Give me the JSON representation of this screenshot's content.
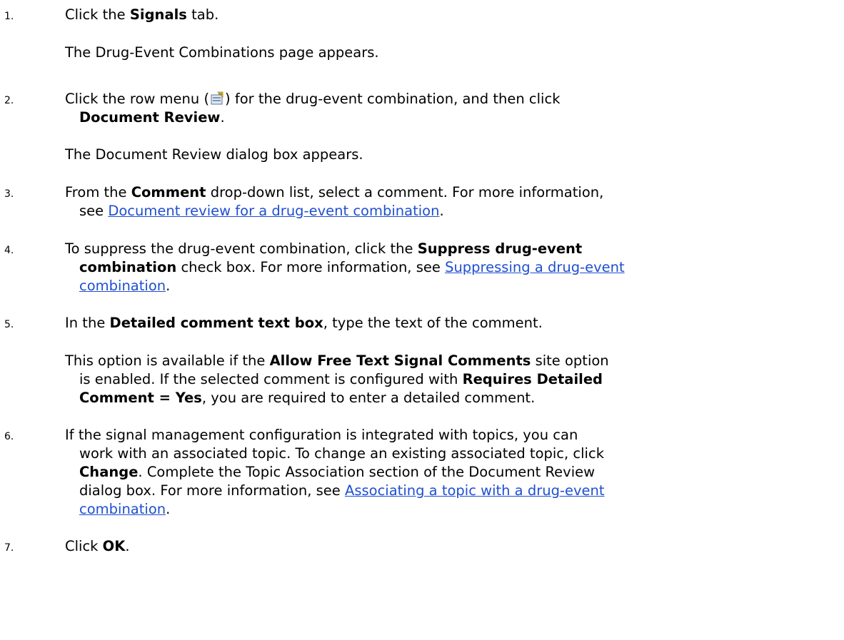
{
  "steps": [
    {
      "number": "1.",
      "text_before": "Click the ",
      "bold": "Signals",
      "text_after": " tab.",
      "result": "The Drug-Event Combinations page appears."
    },
    {
      "number": "2.",
      "text_before": "Click the row menu (",
      "icon": "row-menu-icon",
      "text_mid": ") for the drug-event combination, and then click",
      "bold": "Document Review",
      "text_after": ".",
      "result": "The Document Review dialog box appears."
    },
    {
      "number": "3.",
      "text_before": "From the ",
      "bold": "Comment",
      "text_after": " drop-down list, select a comment. For more information,",
      "text_see": "see ",
      "link": "Document review for a drug-event combination",
      "text_end": "."
    },
    {
      "number": "4.",
      "text_before": "To suppress the drug-event combination, click the ",
      "bold1": "Suppress drug-event",
      "bold2": "combination",
      "text_mid": " check box. For more information, see ",
      "link1": "Suppressing a drug-event",
      "link2": "combination",
      "text_end": "."
    },
    {
      "number": "5.",
      "text_before": "In the ",
      "bold": "Detailed comment text box",
      "text_after": ", type the text of the comment.",
      "note_1a": "This option is available if the ",
      "note_1b": "Allow Free Text Signal Comments",
      "note_1c": " site option",
      "note_2a": "is enabled. If the selected comment is configured with ",
      "note_2b": "Requires Detailed",
      "note_3a": "Comment = Yes",
      "note_3b": ", you are required to enter a detailed comment."
    },
    {
      "number": "6.",
      "line1": "If the signal management configuration is integrated with topics, you can",
      "line2": "work with an associated topic. To change an existing associated topic, click",
      "bold": "Change",
      "line3": ". Complete the Topic Association section of the Document Review",
      "line4": "dialog box. For more information, see ",
      "link1": "Associating a topic with a drug-event",
      "link2": "combination",
      "text_end": "."
    },
    {
      "number": "7.",
      "text_before": "Click ",
      "bold": "OK",
      "text_after": "."
    }
  ],
  "colors": {
    "link": "#1f4fd1",
    "text": "#000000",
    "background": "#ffffff"
  }
}
